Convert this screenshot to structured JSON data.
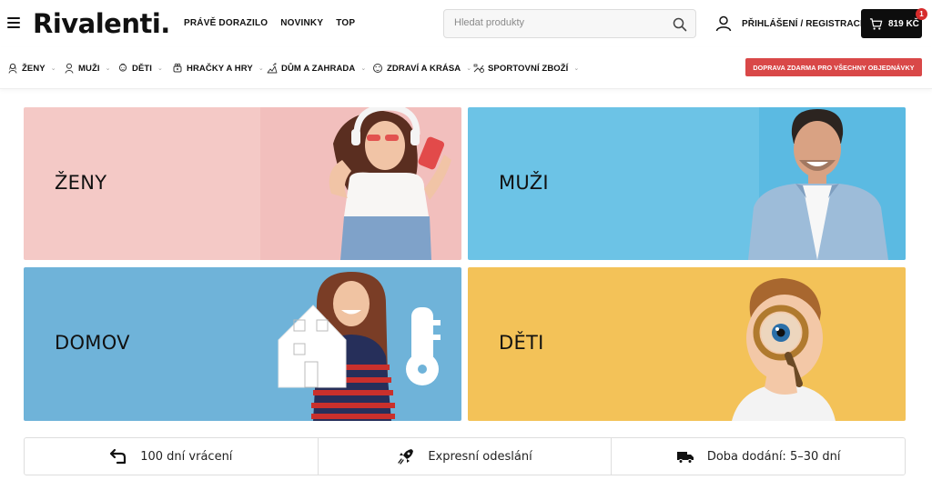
{
  "header": {
    "logo": "Rivalenti.",
    "nav": [
      "PRÁVĚ DORAZILO",
      "NOVINKY",
      "TOP"
    ],
    "search_placeholder": "Hledat produkty",
    "login_label": "PŘIHLÁŠENÍ / REGISTRACE",
    "cart_price": "819 KČ",
    "cart_count": "1"
  },
  "categories": [
    {
      "label": "ŽENY",
      "icon": "woman-icon"
    },
    {
      "label": "MUŽI",
      "icon": "man-icon"
    },
    {
      "label": "DĚTI",
      "icon": "child-icon"
    },
    {
      "label": "HRAČKY A HRY",
      "icon": "toy-icon"
    },
    {
      "label": "DŮM A ZAHRADA",
      "icon": "house-garden-icon"
    },
    {
      "label": "ZDRAVÍ A KRÁSA",
      "icon": "beauty-icon"
    },
    {
      "label": "SPORTOVNÍ ZBOŽÍ",
      "icon": "sport-icon"
    }
  ],
  "shipping_badge": "DOPRAVA ZDARMA PRO VŠECHNY OBJEDNÁVKY",
  "banners": {
    "zeny": "ŽENY",
    "muzi": "MUŽI",
    "domov": "DOMOV",
    "deti": "DĚTI"
  },
  "benefits": [
    {
      "label": "100 dní vrácení",
      "icon": "return-arrow-icon"
    },
    {
      "label": "Expresní odeslání",
      "icon": "rocket-icon"
    },
    {
      "label": "Doba dodání: 5–30 dní",
      "icon": "truck-icon"
    }
  ],
  "colors": {
    "accent_red": "#d94848",
    "cart_bg": "#0d0d0d",
    "banner_zeny": "#f4c9c6",
    "banner_muzi": "#6cc3e6",
    "banner_domov": "#6fb3d9",
    "banner_deti": "#f3c258"
  }
}
